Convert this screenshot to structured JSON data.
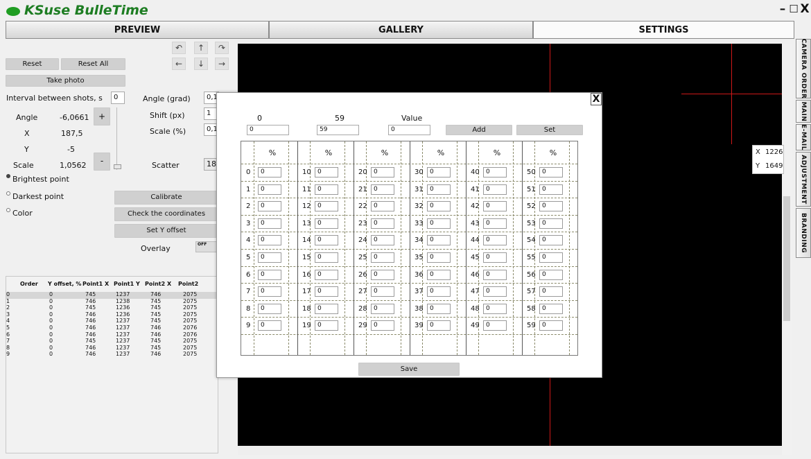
{
  "app": {
    "title": "KSuse BulleTime"
  },
  "window_controls": {
    "minimize": "–",
    "maximize": "☐",
    "close": "X"
  },
  "tabs": {
    "preview": "PREVIEW",
    "gallery": "GALLERY",
    "settings": "SETTINGS"
  },
  "side_tabs": [
    "CAMERA ORDER",
    "MAIN",
    "E-MAIL",
    "ADJUSTMENT",
    "BRANDING"
  ],
  "left_panel": {
    "reset": "Reset",
    "reset_all": "Reset All",
    "take_photo": "Take photo",
    "interval_label": "Interval between shots, s",
    "interval_value": "0",
    "angle_label": "Angle",
    "angle_value": "-6,0661",
    "x_label": "X",
    "x_value": "187,5",
    "y_label": "Y",
    "y_value": "-5",
    "scale_label": "Scale",
    "scale_value": "1,0562",
    "plus": "+",
    "minus": "-",
    "angle_grad_label": "Angle (grad)",
    "angle_grad_value": "0,1",
    "shift_label": "Shift (px)",
    "shift_value": "1",
    "scale_pct_label": "Scale (%)",
    "scale_pct_value": "0,1",
    "scatter_label": "Scatter",
    "scatter_value": "18",
    "brightest": "Brightest point",
    "darkest": "Darkest point",
    "color": "Color",
    "calibrate": "Calibrate",
    "check_coords": "Check the coordinates",
    "set_y_offset": "Set Y offset",
    "overlay_label": "Overlay",
    "overlay_toggle": "OFF",
    "rotate_left": "↶",
    "up": "↑",
    "rotate_right": "↷",
    "left": "←",
    "down": "↓",
    "right": "→"
  },
  "grid": {
    "headers": [
      "Order",
      "Y offset, %",
      "Point1 X",
      "Point1 Y",
      "Point2 X",
      "Point2"
    ],
    "rows": [
      [
        "0",
        "0",
        "745",
        "1237",
        "746",
        "2075"
      ],
      [
        "1",
        "0",
        "746",
        "1238",
        "745",
        "2075"
      ],
      [
        "2",
        "0",
        "745",
        "1236",
        "745",
        "2075"
      ],
      [
        "3",
        "0",
        "746",
        "1236",
        "745",
        "2075"
      ],
      [
        "4",
        "0",
        "746",
        "1237",
        "745",
        "2075"
      ],
      [
        "5",
        "0",
        "746",
        "1237",
        "746",
        "2076"
      ],
      [
        "6",
        "0",
        "746",
        "1237",
        "746",
        "2076"
      ],
      [
        "7",
        "0",
        "745",
        "1237",
        "745",
        "2075"
      ],
      [
        "8",
        "0",
        "746",
        "1237",
        "745",
        "2075"
      ],
      [
        "9",
        "0",
        "746",
        "1237",
        "746",
        "2075"
      ]
    ]
  },
  "coord_box": {
    "x_label": "X",
    "x_value": "1226",
    "y_label": "Y",
    "y_value": "1649"
  },
  "dialog": {
    "close": "X",
    "from_label": "0",
    "to_label": "59",
    "value_label": "Value",
    "from_value": "0",
    "to_value": "59",
    "value_value": "0",
    "add": "Add",
    "set": "Set",
    "save": "Save",
    "col_header": "%",
    "cell_value": "0",
    "columns": [
      [
        "0",
        "1",
        "2",
        "3",
        "4",
        "5",
        "6",
        "7",
        "8",
        "9"
      ],
      [
        "10",
        "11",
        "12",
        "13",
        "14",
        "15",
        "16",
        "17",
        "18",
        "19"
      ],
      [
        "20",
        "21",
        "22",
        "23",
        "24",
        "25",
        "26",
        "27",
        "28",
        "29"
      ],
      [
        "30",
        "31",
        "32",
        "33",
        "34",
        "35",
        "36",
        "37",
        "38",
        "39"
      ],
      [
        "40",
        "41",
        "42",
        "43",
        "44",
        "45",
        "46",
        "47",
        "48",
        "49"
      ],
      [
        "50",
        "51",
        "52",
        "53",
        "54",
        "55",
        "56",
        "57",
        "58",
        "59"
      ]
    ]
  }
}
